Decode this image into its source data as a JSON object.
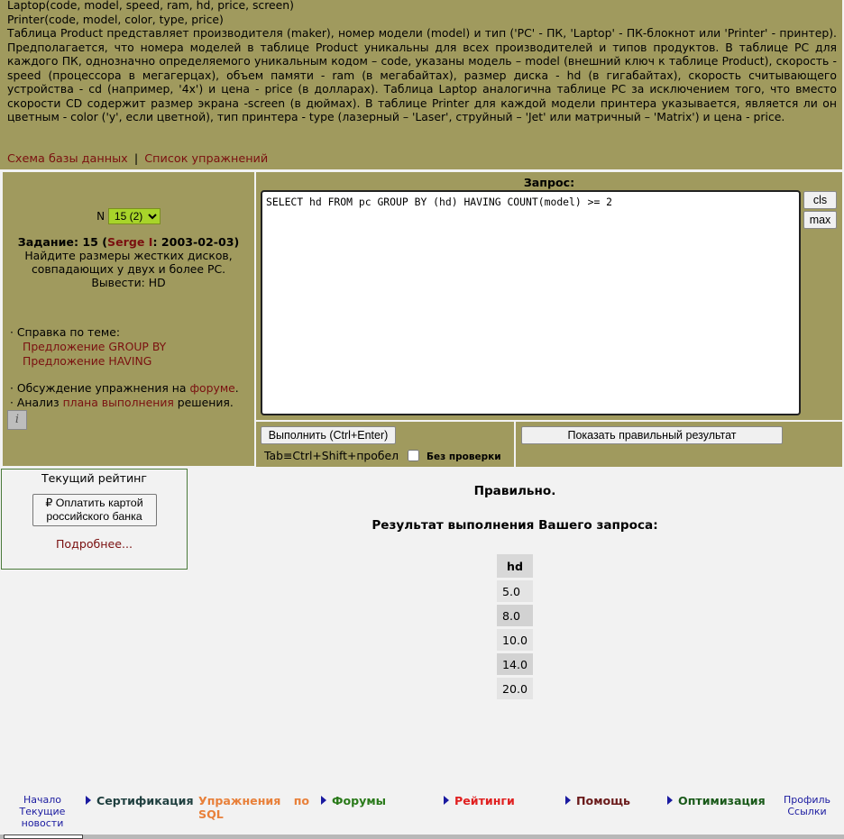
{
  "schema": {
    "line_laptop": "Laptop(code, model, speed, ram, hd, price, screen)",
    "line_printer": "Printer(code, model, color, type, price)",
    "description": "Таблица Product представляет производителя (maker), номер модели (model) и тип ('PC' - ПК, 'Laptop' - ПК-блокнот или 'Printer' - принтер). Предполагается, что номера моделей в таблице Product уникальны для всех производителей и типов продуктов. В таблице PC для каждого ПК, однозначно определяемого уникальным кодом – code, указаны модель – model (внешний ключ к таблице Product), скорость - speed (процессора в мегагерцах), объем памяти - ram (в мегабайтах), размер диска - hd (в гигабайтах), скорость считывающего устройства - cd (например, '4x') и цена - price (в долларах). Таблица Laptop аналогична таблице PC за исключением того, что вместо скорости CD содержит размер экрана -screen (в дюймах). В таблице Printer для каждой модели принтера указывается, является ли он цветным - color ('y', если цветной), тип принтера - type (лазерный – 'Laser', струйный – 'Jet' или матричный – 'Matrix') и цена - price."
  },
  "top_links": {
    "db_schema": "Схема базы данных",
    "separator": "|",
    "exercises": "Список упражнений"
  },
  "task": {
    "n_label": "N",
    "n_selected": "15 (2)",
    "title_prefix": "Задание: 15 (",
    "author": "Serge I",
    "title_suffix": ": 2003-02-03)",
    "text": "Найдите размеры жестких дисков, совпадающих у двух и более PC. Вывести: HD"
  },
  "help": {
    "heading": "· Справка по теме:",
    "link1": "Предложение GROUP BY",
    "link2": "Предложение HAVING",
    "discuss_prefix": "· Обсуждение упражнения на ",
    "discuss_link": "форуме",
    "discuss_suffix": ".",
    "analysis_prefix": "· Анализ ",
    "analysis_link": "плана выполнения",
    "analysis_suffix": " решения.",
    "info_glyph": "i"
  },
  "query": {
    "label": "Запрос:",
    "text": "SELECT hd FROM pc GROUP BY (hd) HAVING COUNT(model) >= 2",
    "cls_label": "cls",
    "max_label": "max"
  },
  "actions": {
    "execute_label": "Выполнить (Ctrl+Enter)",
    "tab_hint": "Tab≡Ctrl+Shift+пробел",
    "no_check_label": "Без проверки",
    "show_correct_label": "Показать правильный результат"
  },
  "rating": {
    "title": "Текущий рейтинг",
    "pay_label": "₽ Оплатить картой российского банка",
    "more_link": "Подробнее..."
  },
  "result": {
    "status": "Правильно.",
    "title": "Результат выполнения Вашего запроса:",
    "column": "hd",
    "rows": [
      "5.0",
      "8.0",
      "10.0",
      "14.0",
      "20.0"
    ]
  },
  "nav": {
    "home": "Начало",
    "news": "Текущие новости",
    "certification": "Сертификация",
    "exercises": "Упражнения по SQL",
    "forums": "Форумы",
    "ratings": "Рейтинги",
    "help": "Помощь",
    "optimization": "Оптимизация",
    "profile": "Профиль",
    "links": "Ссылки"
  },
  "colors": {
    "panel": "#a09a5e",
    "link": "#7a1010",
    "select_bg": "#a8d42a",
    "nav_certification": "#1f3f3f",
    "nav_exercises": "#e8803a",
    "nav_forums": "#2a7a1a",
    "nav_ratings": "#e02020",
    "nav_help": "#6a1a1a",
    "nav_optimization": "#1a5a1a"
  }
}
